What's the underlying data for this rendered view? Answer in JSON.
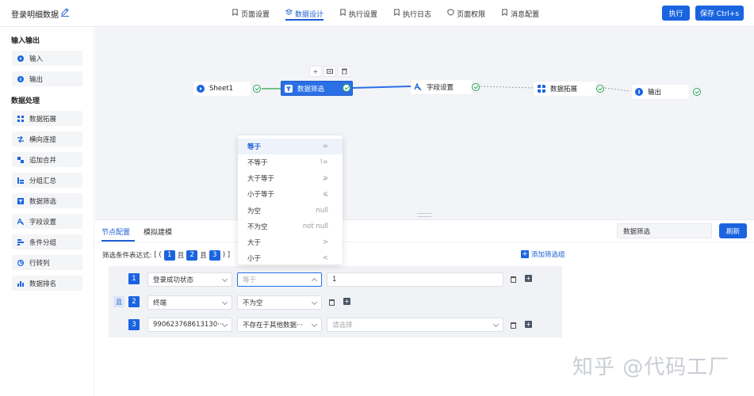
{
  "header": {
    "title": "登录明细数据",
    "tabs": [
      {
        "label": "页面设置",
        "icon": "bookmark-icon",
        "active": false
      },
      {
        "label": "数据设计",
        "icon": "design-icon",
        "active": true
      },
      {
        "label": "执行设置",
        "icon": "bookmark-icon",
        "active": false
      },
      {
        "label": "执行日志",
        "icon": "bookmark-icon",
        "active": false
      },
      {
        "label": "页面权限",
        "icon": "shield-icon",
        "active": false
      },
      {
        "label": "消息配置",
        "icon": "bookmark-icon",
        "active": false
      }
    ],
    "execute_label": "执行",
    "save_label": "保存 Ctrl+s"
  },
  "sidebar": {
    "io_title": "输入输出",
    "io_items": [
      {
        "label": "输入",
        "icon": "input-icon"
      },
      {
        "label": "输出",
        "icon": "output-icon"
      }
    ],
    "proc_title": "数据处理",
    "proc_items": [
      {
        "label": "数据拓展",
        "icon": "grid-icon"
      },
      {
        "label": "横向连接",
        "icon": "join-icon"
      },
      {
        "label": "追加合并",
        "icon": "merge-icon"
      },
      {
        "label": "分组汇总",
        "icon": "group-icon"
      },
      {
        "label": "数据筛选",
        "icon": "filter-icon"
      },
      {
        "label": "字段设置",
        "icon": "field-icon"
      },
      {
        "label": "条件分组",
        "icon": "condition-icon"
      },
      {
        "label": "行转列",
        "icon": "pivot-icon"
      },
      {
        "label": "数据排名",
        "icon": "rank-icon"
      }
    ]
  },
  "canvas": {
    "nodes": {
      "sheet": "Sheet1",
      "filter": "数据筛选",
      "field": "字段设置",
      "expand": "数据拓展",
      "output": "输出"
    },
    "toolbar": {
      "add": "+",
      "comment": "▭",
      "delete": "🗑"
    }
  },
  "dropdown": {
    "options": [
      {
        "label": "等于",
        "symbol": "=",
        "selected": true
      },
      {
        "label": "不等于",
        "symbol": "!=",
        "selected": false
      },
      {
        "label": "大于等于",
        "symbol": "⩾",
        "selected": false
      },
      {
        "label": "小于等于",
        "symbol": "⩽",
        "selected": false
      },
      {
        "label": "为空",
        "symbol": "null",
        "selected": false
      },
      {
        "label": "不为空",
        "symbol": "not null",
        "selected": false
      },
      {
        "label": "大于",
        "symbol": ">",
        "selected": false
      },
      {
        "label": "小于",
        "symbol": "<",
        "selected": false
      }
    ]
  },
  "panel": {
    "tabs": [
      "节点配置",
      "模拟建模"
    ],
    "node_name": "数据筛选",
    "refresh_label": "刷新",
    "expr_label": "筛选条件表达式:",
    "expr_open": "[ (",
    "expr_and": "且",
    "expr_close": ") ]",
    "add_group_label": "添加筛选组",
    "and_label": "且",
    "rows": [
      {
        "num": "1",
        "field": "登录成功状态",
        "operator": "等于",
        "value": "1",
        "value_placeholder": ""
      },
      {
        "num": "2",
        "field": "终端",
        "operator": "不为空",
        "value": "",
        "value_placeholder": ""
      },
      {
        "num": "3",
        "field": "990623768613130···",
        "operator": "不存在于其他数据···",
        "value": "",
        "value_placeholder": "请选择"
      }
    ]
  },
  "watermark": "知乎 @代码工厂"
}
